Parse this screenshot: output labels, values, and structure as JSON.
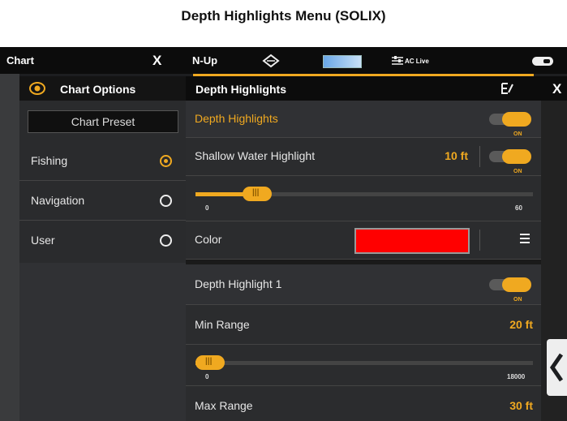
{
  "caption": "Depth Highlights Menu (SOLIX)",
  "topbar": {
    "chart_label": "Chart",
    "close_glyph": "X",
    "orientation": "N-Up",
    "ac_live": "AC Live"
  },
  "chart_options": {
    "title": "Chart Options",
    "preset_button": "Chart Preset",
    "presets": [
      {
        "label": "Fishing",
        "selected": true
      },
      {
        "label": "Navigation",
        "selected": false
      },
      {
        "label": "User",
        "selected": false
      }
    ]
  },
  "depth_panel": {
    "title": "Depth Highlights",
    "close_glyph": "X",
    "rows": {
      "depth_highlights": {
        "label": "Depth Highlights",
        "toggle": "ON"
      },
      "shallow": {
        "label": "Shallow Water Highlight",
        "value": "10 ft",
        "toggle": "ON"
      },
      "shallow_slider": {
        "min": "0",
        "max": "60",
        "level": 10
      },
      "color": {
        "label": "Color",
        "swatch": "#ff0000"
      },
      "highlight1": {
        "label": "Depth Highlight 1",
        "toggle": "ON"
      },
      "min_range": {
        "label": "Min Range",
        "value": "20 ft"
      },
      "min_slider": {
        "min": "0",
        "max": "18000",
        "level": 20
      },
      "max_range": {
        "label": "Max Range",
        "value": "30 ft"
      }
    }
  },
  "colors": {
    "accent": "#f0a920"
  }
}
